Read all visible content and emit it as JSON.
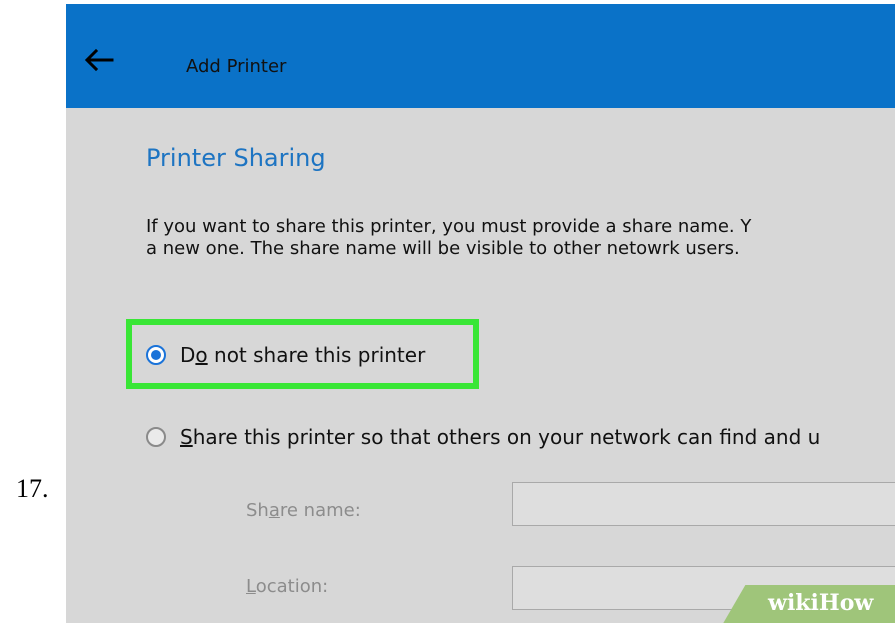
{
  "step": "17.",
  "window": {
    "title": "Add Printer",
    "back_icon": "arrow-left-icon"
  },
  "heading": "Printer Sharing",
  "description": [
    "If you want to share this printer, you must provide a share name. Y",
    "a new one. The share name will be visible to other netowrk users."
  ],
  "options": [
    {
      "pre": "D",
      "u": "o",
      "post": " not share this printer",
      "selected": true
    },
    {
      "pre": "",
      "u": "S",
      "post": "hare this printer so that others on your network can find and u",
      "selected": false
    }
  ],
  "fields": [
    {
      "pre": "Sh",
      "u": "a",
      "post": "re name:",
      "value": ""
    },
    {
      "pre": "",
      "u": "L",
      "post": "ocation:",
      "value": ""
    }
  ],
  "watermark": {
    "part1": "wiki",
    "part2": "How"
  },
  "colors": {
    "titlebar": "#0a72c8",
    "heading": "#1d74c2",
    "radio_selected": "#1a73d9",
    "highlight": "#39e636",
    "background": "#d7d7d7"
  }
}
